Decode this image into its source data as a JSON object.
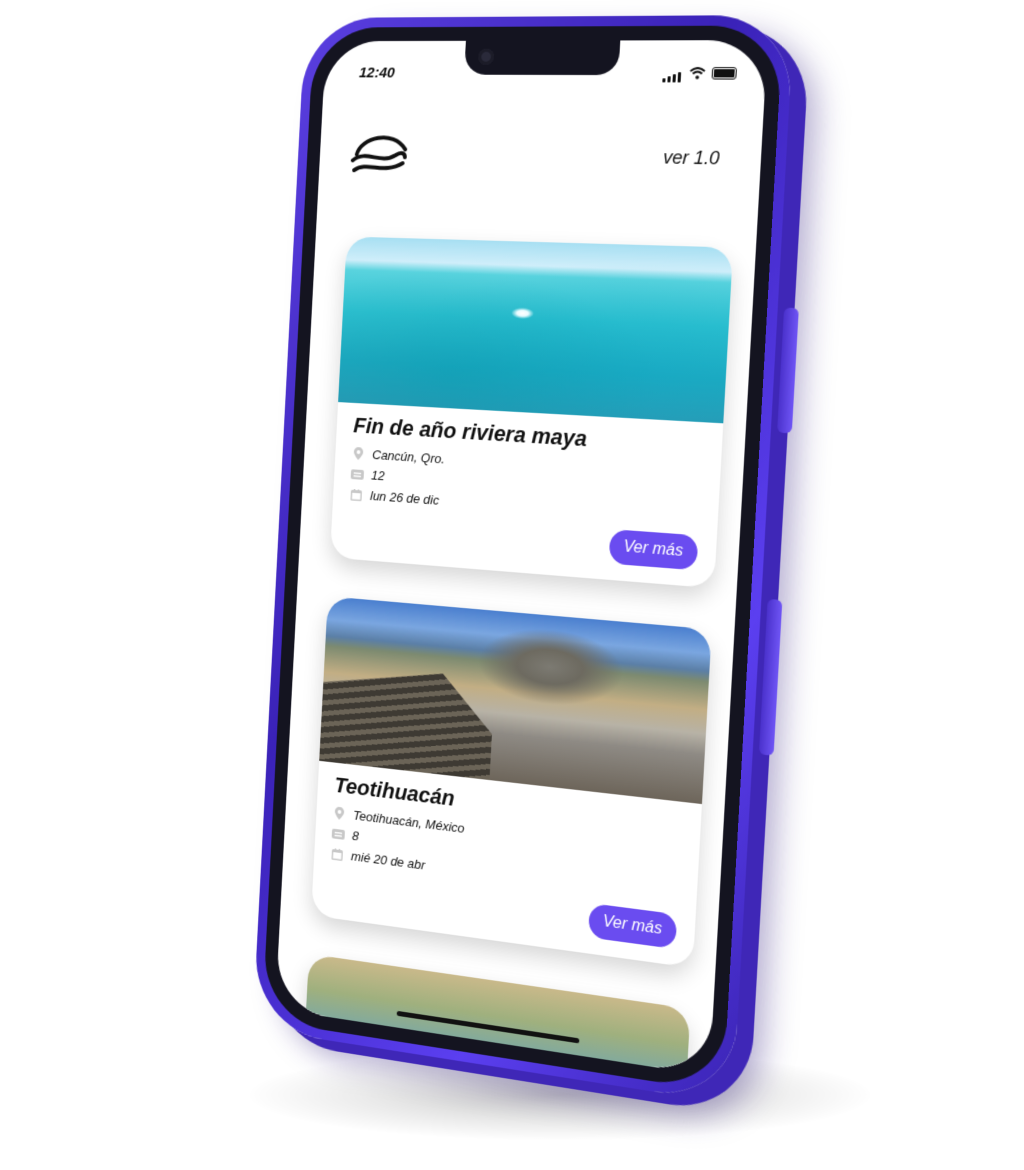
{
  "status_bar": {
    "time": "12:40"
  },
  "header": {
    "version": "ver 1.0"
  },
  "cards": [
    {
      "title": "Fin de año riviera maya",
      "location": "Cancún, Qro.",
      "tickets": "12",
      "date": "lun 26 de dic",
      "button": "Ver más"
    },
    {
      "title": "Teotihuacán",
      "location": "Teotihuacán, México",
      "tickets": "8",
      "date": "mié 20 de abr",
      "button": "Ver más"
    }
  ],
  "colors": {
    "accent": "#6a4cf0",
    "phone_frame": "#4a31cc",
    "text": "#111111"
  },
  "icons": [
    "wave-logo-icon",
    "location-pin-icon",
    "ticket-icon",
    "calendar-icon",
    "signal-icon",
    "wifi-icon",
    "battery-icon"
  ]
}
